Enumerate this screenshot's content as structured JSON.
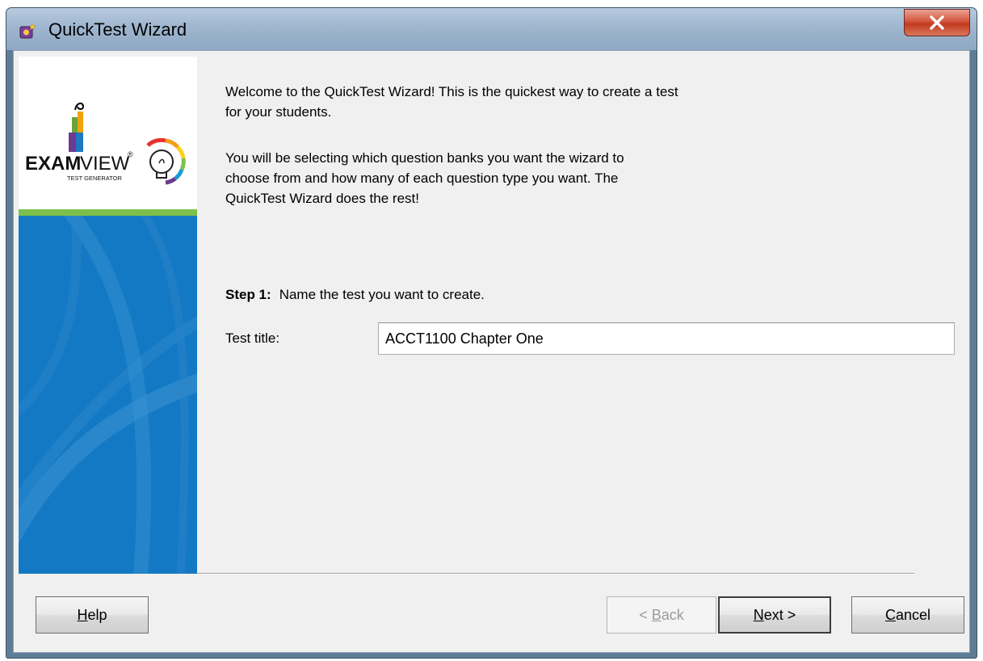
{
  "window": {
    "title": "QuickTest Wizard"
  },
  "logo": {
    "brand_bold": "EXAM",
    "brand_light": "VIEW",
    "registered": "®",
    "tagline": "TEST GENERATOR"
  },
  "content": {
    "intro": "Welcome to the QuickTest Wizard!  This is the quickest way to create a test\nfor your students.",
    "description": "You will be selecting which question banks you want the wizard to\nchoose from and how many of each question type you want.  The\nQuickTest Wizard does the rest!",
    "step_label": "Step 1:",
    "step_text": "Name the test you want to create.",
    "title_field_label": "Test title:",
    "title_field_value": "ACCT1100 Chapter One"
  },
  "buttons": {
    "help": {
      "mnemonic": "H",
      "rest": "elp"
    },
    "back": {
      "prefix": "< ",
      "mnemonic": "B",
      "rest": "ack"
    },
    "next": {
      "mnemonic": "N",
      "rest": "ext >"
    },
    "cancel": {
      "mnemonic": "C",
      "rest": "ancel"
    }
  },
  "colors": {
    "sidebar_blue": "#1479c4",
    "sidebar_green": "#7cc04b",
    "close_red": "#c23a20"
  },
  "icons": {
    "app": "quicktest-app-icon",
    "close": "close-x-icon"
  }
}
